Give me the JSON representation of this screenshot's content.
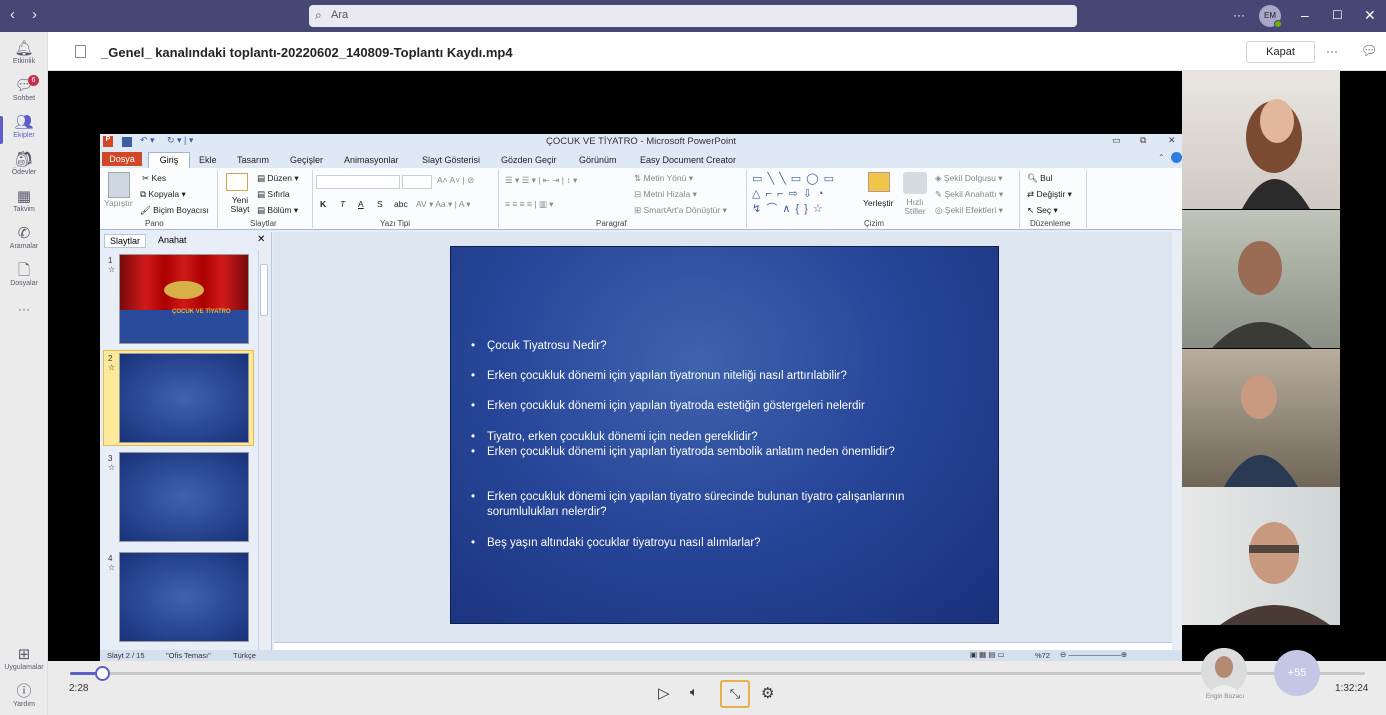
{
  "teams": {
    "search_placeholder": "Ara",
    "avatar_initials": "EM",
    "more": "···"
  },
  "rail": {
    "items": [
      {
        "label": "Etkinlik",
        "icon": "bell-icon"
      },
      {
        "label": "Sohbet",
        "icon": "chat-icon",
        "badge": "6"
      },
      {
        "label": "Ekipler",
        "icon": "teams-icon"
      },
      {
        "label": "Ödevler",
        "icon": "assignments-icon"
      },
      {
        "label": "Takvim",
        "icon": "calendar-icon"
      },
      {
        "label": "Aramalar",
        "icon": "phone-icon"
      },
      {
        "label": "Dosyalar",
        "icon": "file-icon"
      }
    ],
    "more": "···",
    "apps": "Uygulamalar",
    "help": "Yardım"
  },
  "header": {
    "title": "_Genel_ kanalındaki toplantı-20220602_140809-Toplantı Kaydı.mp4",
    "close_label": "Kapat",
    "more": "···"
  },
  "ppt": {
    "window_title": "ÇOCUK VE TİYATRO - Microsoft PowerPoint",
    "tabs": [
      "Dosya",
      "Giriş",
      "Ekle",
      "Tasarım",
      "Geçişler",
      "Animasyonlar",
      "Slayt Gösterisi",
      "Gözden Geçir",
      "Görünüm",
      "Easy Document Creator"
    ],
    "ribbon": {
      "pano": {
        "paste": "Yapıştır",
        "cut": "Kes",
        "copy": "Kopyala",
        "format": "Biçim Boyacısı",
        "group": "Pano"
      },
      "slaytlar": {
        "new": "Yeni Slayt",
        "layout": "Düzen",
        "reset": "Sıfırla",
        "section": "Bölüm",
        "group": "Slaytlar"
      },
      "yazi_tipi": {
        "group": "Yazı Tipi",
        "bold": "K",
        "italic": "T",
        "underline": "A",
        "strike": "S",
        "shadow": "abc"
      },
      "paragraf": {
        "group": "Paragraf",
        "dir": "Metin Yönü",
        "align": "Metni Hizala",
        "smartart": "SmartArt'a Dönüştür"
      },
      "cizim": {
        "group": "Çizim",
        "arrange": "Yerleştir",
        "quick": "Hızlı Stiller",
        "fill": "Şekil Dolgusu",
        "outline": "Şekil Anahattı",
        "effects": "Şekil Efektleri"
      },
      "duzenleme": {
        "group": "Düzenleme",
        "find": "Bul",
        "replace": "Değiştir",
        "select": "Seç"
      }
    },
    "panel_tabs": [
      "Slaytlar",
      "Anahat"
    ],
    "thumb1_title": "ÇOCUK VE TİYATRO",
    "slide_bullets": [
      "Çocuk Tiyatrosu Nedir?",
      "Erken çocukluk dönemi için yapılan tiyatronun niteliği nasıl arttırılabilir?",
      "Erken çocukluk dönemi için yapılan tiyatroda estetiğin göstergeleri nelerdir",
      "Tiyatro, erken çocukluk dönemi için neden gereklidir?",
      "Erken çocukluk dönemi için yapılan tiyatroda sembolik anlatım neden önemlidir?",
      "Erken çocukluk dönemi için yapılan tiyatro sürecinde bulunan tiyatro çalışanlarının sorumlulukları nelerdir?",
      "Beş yaşın altındaki çocuklar tiyatroyu nasıl alımlarlar?"
    ],
    "status": {
      "slide": "Slayt 2 / 15",
      "theme": "\"Ofis Teması\"",
      "lang": "Türkçe",
      "zoom": "%72"
    }
  },
  "player": {
    "current": "2:28",
    "total": "1:32:24",
    "progress_fraction": 0.025,
    "presenter": "Engin Bozacı",
    "more_participants": "+55"
  }
}
